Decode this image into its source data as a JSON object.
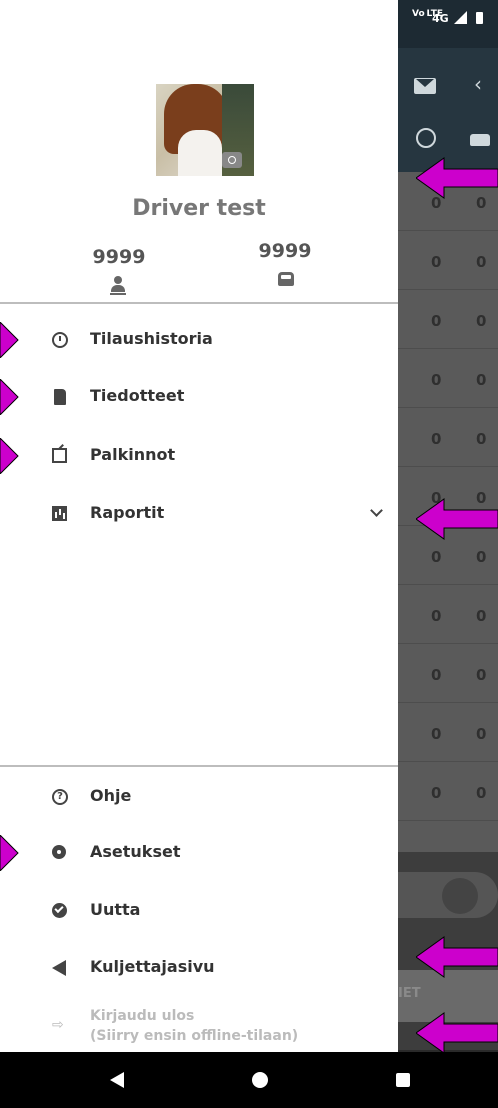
{
  "status_bar": {
    "network_label": "Vo LTE",
    "network_type": "4G"
  },
  "profile": {
    "name": "Driver test",
    "stat_left": "9999",
    "stat_right": "9999"
  },
  "menu": {
    "items": [
      {
        "label": "Tilaushistoria",
        "icon": "history-icon"
      },
      {
        "label": "Tiedotteet",
        "icon": "document-icon"
      },
      {
        "label": "Palkinnot",
        "icon": "external-link-icon"
      },
      {
        "label": "Raportit",
        "icon": "bar-chart-icon",
        "expandable": true
      }
    ],
    "bottom_items": [
      {
        "label": "Ohje",
        "icon": "help-icon"
      },
      {
        "label": "Asetukset",
        "icon": "gear-icon"
      },
      {
        "label": "Uutta",
        "icon": "new-badge-icon"
      },
      {
        "label": "Kuljettajasivu",
        "icon": "megaphone-icon"
      }
    ],
    "logout": {
      "line1": "Kirjaudu ulos",
      "line2": "(Siirry ensin offline-tilaan)"
    }
  },
  "background_list": {
    "rows": [
      [
        "0",
        "0"
      ],
      [
        "0",
        "0"
      ],
      [
        "0",
        "0"
      ],
      [
        "0",
        "0"
      ],
      [
        "0",
        "0"
      ],
      [
        "0",
        "0"
      ],
      [
        "0",
        "0"
      ],
      [
        "0",
        "0"
      ],
      [
        "0",
        "0"
      ],
      [
        "0",
        "0"
      ],
      [
        "0",
        "0"
      ]
    ],
    "peek_text": "IET"
  },
  "colors": {
    "annotation_arrow": "#cc00cc",
    "drawer_bg": "#ffffff",
    "toolbar_bg": "#263640"
  }
}
